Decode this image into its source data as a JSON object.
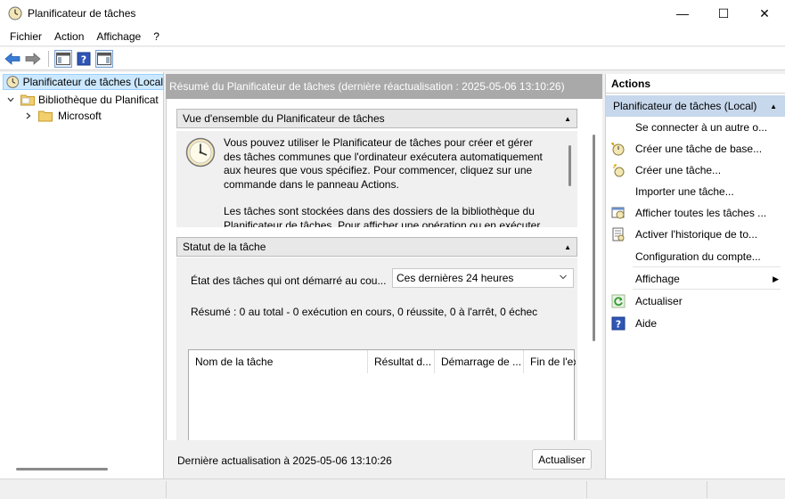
{
  "window": {
    "title": "Planificateur de tâches",
    "minimize": "—",
    "maximize": "☐",
    "close": "✕"
  },
  "menu": [
    "Fichier",
    "Action",
    "Affichage",
    "?"
  ],
  "tree": {
    "items": [
      {
        "label": "Planificateur de tâches (Local",
        "icon": "clock-icon",
        "selected": true
      },
      {
        "label": "Bibliothèque du Planificat",
        "icon": "folder-icon",
        "expanded": true
      },
      {
        "label": "Microsoft",
        "icon": "folder-icon",
        "expanded": false
      }
    ]
  },
  "center": {
    "header": "Résumé du Planificateur de tâches (dernière réactualisation : 2025-05-06 13:10:26)",
    "overview": {
      "title": "Vue d'ensemble du Planificateur de tâches",
      "paragraph1": "Vous pouvez utiliser le Planificateur de tâches pour créer et gérer des tâches communes que l'ordinateur exécutera automatiquement aux heures que vous spécifiez. Pour commencer, cliquez sur une commande dans le panneau Actions.",
      "paragraph2": "Les tâches sont stockées dans des dossiers de la bibliothèque du Planificateur de tâches. Pour afficher une opération ou en exécuter"
    },
    "status": {
      "title": "Statut de la tâche",
      "state_label": "État des tâches qui ont démarré au cou...",
      "period": "Ces dernières 24 heures",
      "summary": "Résumé : 0 au total - 0 exécution en cours, 0 réussite, 0 à l'arrêt, 0 échec",
      "columns": [
        "Nom de la tâche",
        "Résultat d...",
        "Démarrage de ...",
        "Fin de l'ex"
      ]
    },
    "footer": {
      "last_refresh": "Dernière actualisation à 2025-05-06 13:10:26",
      "refresh_button": "Actualiser"
    }
  },
  "actions": {
    "header": "Actions",
    "section": "Planificateur de tâches (Local)",
    "items": [
      {
        "label": "Se connecter à un autre o...",
        "icon": ""
      },
      {
        "label": "Créer une tâche de base...",
        "icon": "wizard-icon"
      },
      {
        "label": "Créer une tâche...",
        "icon": "new-task-icon"
      },
      {
        "label": "Importer une tâche...",
        "icon": ""
      },
      {
        "label": "Afficher toutes les tâches ...",
        "icon": "running-tasks-icon"
      },
      {
        "label": "Activer l'historique de to...",
        "icon": "history-icon"
      },
      {
        "label": "Configuration du compte...",
        "icon": ""
      },
      {
        "label": "Affichage",
        "icon": "",
        "submenu": true
      },
      {
        "label": "Actualiser",
        "icon": "refresh-icon"
      },
      {
        "label": "Aide",
        "icon": "help-icon"
      }
    ]
  }
}
